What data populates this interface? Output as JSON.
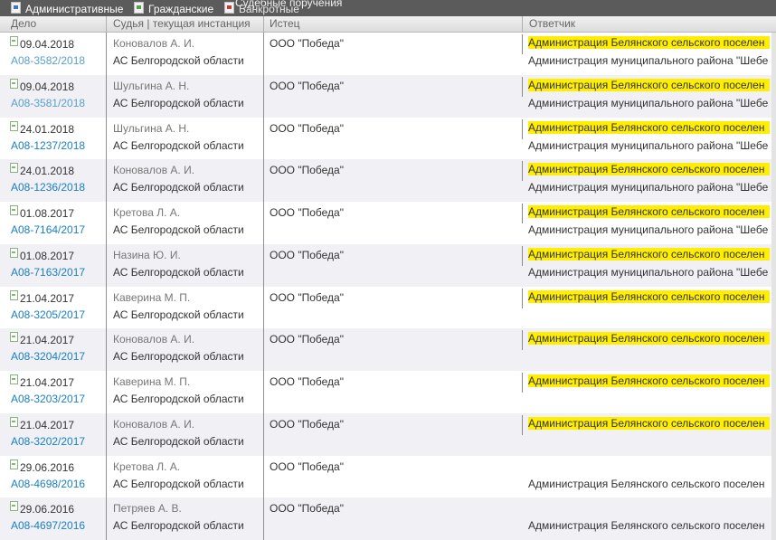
{
  "tabs": [
    {
      "label": "Административные",
      "icon": "admin-doc-icon"
    },
    {
      "label": "Гражданские",
      "icon": "civil-doc-icon"
    },
    {
      "label": "Банкротные",
      "icon": "bankrupt-doc-icon"
    }
  ],
  "tab_overlap_label": "Судебные поручения",
  "columns": {
    "delo": "Дело",
    "judge": "Судья | текущая инстанция",
    "plaintiff": "Истец",
    "defendant": "Ответчик"
  },
  "rows": [
    {
      "date": "09.04.2018",
      "case": "А08-3582/2018",
      "visited": true,
      "judge": "Коновалов А. И.",
      "court": "АС Белгородской области",
      "plaintiff": "ООО \"Победа\"",
      "def1": "Администрация Белянского сельского поселен",
      "def1_highlight": true,
      "def2": "Администрация муниципального района \"Шебе"
    },
    {
      "date": "09.04.2018",
      "case": "А08-3581/2018",
      "visited": true,
      "judge": "Шульгина А. Н.",
      "court": "АС Белгородской области",
      "plaintiff": "ООО \"Победа\"",
      "def1": "Администрация Белянского сельского поселен",
      "def1_highlight": true,
      "def2": "Администрация муниципального района \"Шебе"
    },
    {
      "date": "24.01.2018",
      "case": "А08-1237/2018",
      "visited": false,
      "judge": "Шульгина А. Н.",
      "court": "АС Белгородской области",
      "plaintiff": "ООО \"Победа\"",
      "def1": "Администрация Белянского сельского поселен",
      "def1_highlight": true,
      "def2": "Администрация муниципального района \"Шебе"
    },
    {
      "date": "24.01.2018",
      "case": "А08-1236/2018",
      "visited": false,
      "judge": "Коновалов А. И.",
      "court": "АС Белгородской области",
      "plaintiff": "ООО \"Победа\"",
      "def1": "Администрация Белянского сельского поселен",
      "def1_highlight": true,
      "def2": "Администрация муниципального района \"Шебе"
    },
    {
      "date": "01.08.2017",
      "case": "А08-7164/2017",
      "visited": false,
      "judge": "Кретова Л. А.",
      "court": "АС Белгородской области",
      "plaintiff": "ООО \"Победа\"",
      "def1": "Администрация Белянского сельского поселен",
      "def1_highlight": true,
      "def2": "Администрация муниципального района \"Шебе"
    },
    {
      "date": "01.08.2017",
      "case": "А08-7163/2017",
      "visited": false,
      "judge": "Назина Ю. И.",
      "court": "АС Белгородской области",
      "plaintiff": "ООО \"Победа\"",
      "def1": "Администрация Белянского сельского поселен",
      "def1_highlight": true,
      "def2": "Администрация муниципального района \"Шебе"
    },
    {
      "date": "21.04.2017",
      "case": "А08-3205/2017",
      "visited": false,
      "judge": "Каверина М. П.",
      "court": "АС Белгородской области",
      "plaintiff": "ООО \"Победа\"",
      "def1": "Администрация Белянского сельского поселен",
      "def1_highlight": true,
      "def2": ""
    },
    {
      "date": "21.04.2017",
      "case": "А08-3204/2017",
      "visited": false,
      "judge": "Коновалов А. И.",
      "court": "АС Белгородской области",
      "plaintiff": "ООО \"Победа\"",
      "def1": "Администрация Белянского сельского поселен",
      "def1_highlight": true,
      "def2": ""
    },
    {
      "date": "21.04.2017",
      "case": "А08-3203/2017",
      "visited": false,
      "judge": "Каверина М. П.",
      "court": "АС Белгородской области",
      "plaintiff": "ООО \"Победа\"",
      "def1": "Администрация Белянского сельского поселен",
      "def1_highlight": true,
      "def2": ""
    },
    {
      "date": "21.04.2017",
      "case": "А08-3202/2017",
      "visited": false,
      "judge": "Коновалов А. И.",
      "court": "АС Белгородской области",
      "plaintiff": "ООО \"Победа\"",
      "def1": "Администрация Белянского сельского поселен",
      "def1_highlight": true,
      "def2": ""
    },
    {
      "date": "29.06.2016",
      "case": "А08-4698/2016",
      "visited": false,
      "judge": "Кретова Л. А.",
      "court": "АС Белгородской области",
      "plaintiff": "ООО \"Победа\"",
      "def1": "",
      "def1_highlight": false,
      "def2": "Администрация Белянского сельского поселен"
    },
    {
      "date": "29.06.2016",
      "case": "А08-4697/2016",
      "visited": false,
      "judge": "Петряев А. В.",
      "court": "АС Белгородской области",
      "plaintiff": "ООО \"Победа\"",
      "def1": "",
      "def1_highlight": false,
      "def2": "Администрация Белянского сельского поселен"
    }
  ]
}
